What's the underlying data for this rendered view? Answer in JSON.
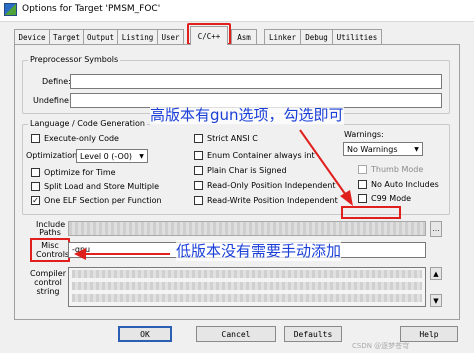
{
  "window": {
    "title": "Options for Target 'PMSM_FOC'"
  },
  "tabs": [
    {
      "label": "Device"
    },
    {
      "label": "Target"
    },
    {
      "label": "Output"
    },
    {
      "label": "Listing"
    },
    {
      "label": "User"
    },
    {
      "label": "C/C++"
    },
    {
      "label": "Asm"
    },
    {
      "label": "Linker"
    },
    {
      "label": "Debug"
    },
    {
      "label": "Utilities"
    }
  ],
  "active_tab": "C/C++",
  "preprocessor": {
    "title": "Preprocessor Symbols",
    "define_label": "Define:",
    "define_value": "",
    "undefine_label": "Undefine:",
    "undefine_value": ""
  },
  "language": {
    "title": "Language / Code Generation",
    "execute_only": {
      "label": "Execute-only Code",
      "checked": false
    },
    "optimization_label": "Optimization:",
    "optimization_value": "Level 0 (-O0)",
    "optimize_time": {
      "label": "Optimize for Time",
      "checked": false
    },
    "split_load": {
      "label": "Split Load and Store Multiple",
      "checked": false
    },
    "one_elf": {
      "label": "One ELF Section per Function",
      "checked": true
    },
    "strict_ansi": {
      "label": "Strict ANSI C",
      "checked": false
    },
    "enum_int": {
      "label": "Enum Container always int",
      "checked": false
    },
    "plain_char": {
      "label": "Plain Char is Signed",
      "checked": false
    },
    "ro_pi": {
      "label": "Read-Only Position Independent",
      "checked": false
    },
    "rw_pi": {
      "label": "Read-Write Position Independent",
      "checked": false
    },
    "warnings_label": "Warnings:",
    "warnings_value": "No Warnings",
    "thumb_mode": {
      "label": "Thumb Mode",
      "checked": false
    },
    "no_auto_includes": {
      "label": "No Auto Includes",
      "checked": false
    },
    "c99_mode": {
      "label": "C99 Mode",
      "checked": false
    }
  },
  "include_paths_label": "Include Paths",
  "misc_controls_label": "Misc Controls",
  "misc_controls_value": "-gnu",
  "compiler_string_label": "Compiler control string",
  "buttons": {
    "ok": "OK",
    "cancel": "Cancel",
    "defaults": "Defaults",
    "help": "Help"
  },
  "annotations": {
    "top": "高版本有gun选项，勾选即可",
    "bottom": "低版本没有需要手动添加"
  },
  "watermark": "CSDN @逐梦苍穹",
  "colors": {
    "annotation_text": "#1a3fd8",
    "highlight_box": "#e0201c",
    "arrow": "#e0201c"
  }
}
